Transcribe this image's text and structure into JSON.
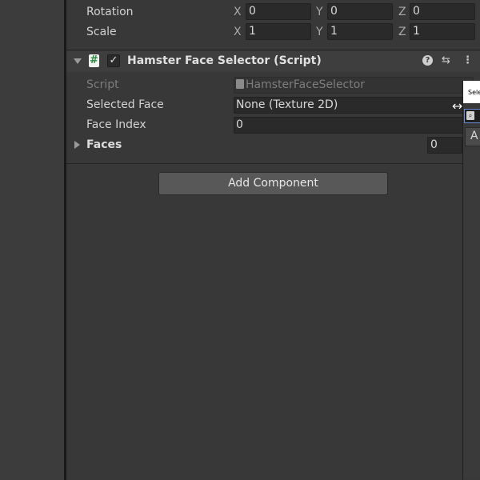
{
  "transform": {
    "rotation": {
      "label": "Rotation",
      "x_label": "X",
      "x": "0",
      "y_label": "Y",
      "y": "0",
      "z_label": "Z",
      "z": "0"
    },
    "scale": {
      "label": "Scale",
      "x_label": "X",
      "x": "1",
      "y_label": "Y",
      "y": "1",
      "z_label": "Z",
      "z": "1"
    }
  },
  "component": {
    "title": "Hamster Face Selector (Script)",
    "icon_glyph": "#",
    "enabled_check": "✓",
    "help_glyph": "?",
    "presets_glyph": "⇆",
    "more_glyph": "⋮",
    "properties": {
      "script_label": "Script",
      "script_value": "HamsterFaceSelector",
      "selected_face_label": "Selected Face",
      "selected_face_value": "None (Texture 2D)",
      "face_index_label": "Face Index",
      "face_index_value": "0",
      "faces_label": "Faces",
      "faces_size": "0"
    }
  },
  "add_component_label": "Add Component",
  "picker": {
    "title": "Sele",
    "search_glyph": "⌕",
    "tab_label": "A"
  },
  "cursor_glyph": "↔"
}
